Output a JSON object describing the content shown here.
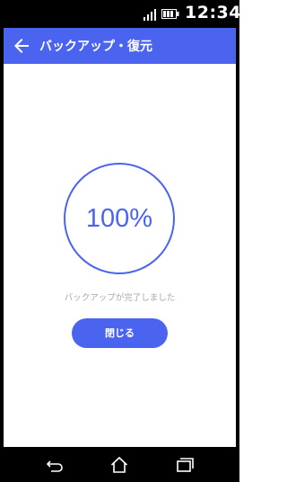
{
  "status_bar": {
    "time": "12:34",
    "signal_icon": "signal-icon",
    "battery_icon": "battery-icon"
  },
  "app_bar": {
    "title": "バックアップ・復元",
    "back_icon": "arrow-back-icon",
    "color": "#4a64f0"
  },
  "main": {
    "progress": {
      "value": 100,
      "label": "100%"
    },
    "message": "バックアップが完了しました",
    "close_button_label": "閉じる"
  },
  "nav_bar": {
    "back_icon": "nav-back-icon",
    "home_icon": "home-icon",
    "recents_icon": "recents-icon"
  }
}
